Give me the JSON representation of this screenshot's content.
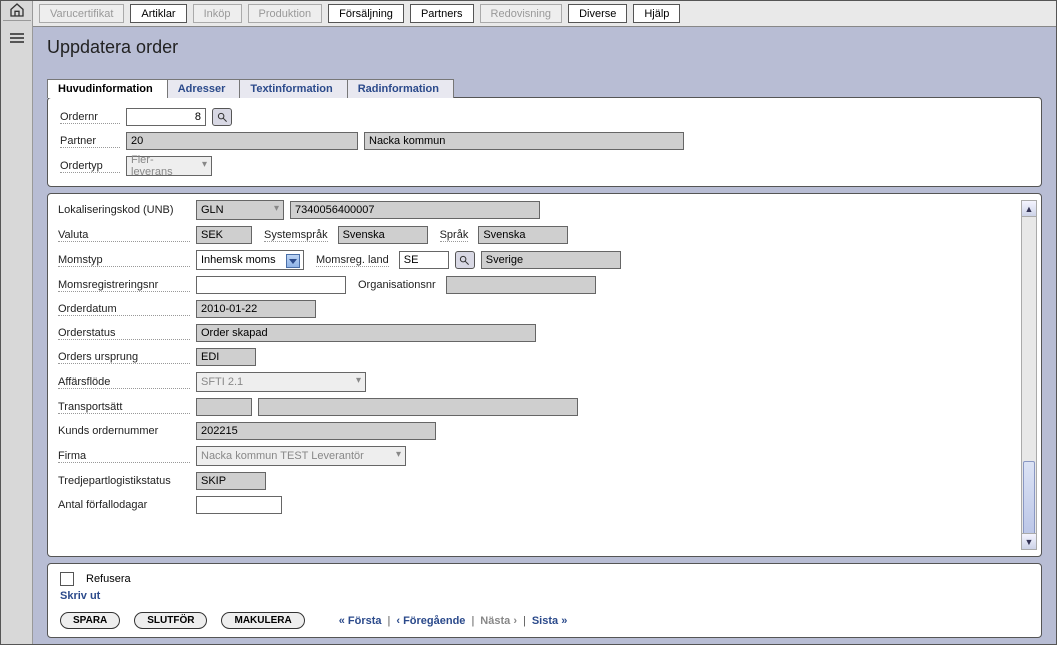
{
  "topnav": {
    "items": [
      {
        "label": "Varucertifikat",
        "disabled": true
      },
      {
        "label": "Artiklar",
        "disabled": false
      },
      {
        "label": "Inköp",
        "disabled": true
      },
      {
        "label": "Produktion",
        "disabled": true
      },
      {
        "label": "Försäljning",
        "disabled": false
      },
      {
        "label": "Partners",
        "disabled": false
      },
      {
        "label": "Redovisning",
        "disabled": true
      },
      {
        "label": "Diverse",
        "disabled": false
      },
      {
        "label": "Hjälp",
        "disabled": false
      }
    ]
  },
  "page": {
    "title": "Uppdatera order"
  },
  "tabs": [
    {
      "label": "Huvudinformation",
      "active": true
    },
    {
      "label": "Adresser",
      "active": false
    },
    {
      "label": "Textinformation",
      "active": false
    },
    {
      "label": "Radinformation",
      "active": false
    }
  ],
  "header_form": {
    "ordernr_label": "Ordernr",
    "ordernr_value": "8",
    "partner_label": "Partner",
    "partner_code": "20",
    "partner_name": "Nacka kommun",
    "ordertyp_label": "Ordertyp",
    "ordertyp_value": "Fler-leverans"
  },
  "details": {
    "lokkod_label": "Lokaliseringskod (UNB)",
    "lokkod_type": "GLN",
    "lokkod_value": "7340056400007",
    "valuta_label": "Valuta",
    "valuta_value": "SEK",
    "systemsprak_label": "Systemspråk",
    "systemsprak_value": "Svenska",
    "sprak_label": "Språk",
    "sprak_value": "Svenska",
    "momstyp_label": "Momstyp",
    "momstyp_value": "Inhemsk moms",
    "momsregland_label": "Momsreg. land",
    "momsregland_code": "SE",
    "momsregland_name": "Sverige",
    "momsregnr_label": "Momsregistreringsnr",
    "momsregnr_value": "",
    "orgnr_label": "Organisationsnr",
    "orgnr_value": "",
    "orderdatum_label": "Orderdatum",
    "orderdatum_value": "2010-01-22",
    "orderstatus_label": "Orderstatus",
    "orderstatus_value": "Order skapad",
    "ursprung_label": "Orders ursprung",
    "ursprung_value": "EDI",
    "affarsflode_label": "Affärsflöde",
    "affarsflode_value": "SFTI 2.1",
    "transportsatt_label": "Transportsätt",
    "transportsatt_code": "",
    "transportsatt_name": "",
    "kundorder_label": "Kunds ordernummer",
    "kundorder_value": "202215",
    "firma_label": "Firma",
    "firma_value": "Nacka kommun TEST Leverantör",
    "tpl_label": "Tredjepartlogistikstatus",
    "tpl_value": "SKIP",
    "forfallo_label": "Antal förfallodagar",
    "forfallo_value": ""
  },
  "footer": {
    "refusera_label": "Refusera",
    "skrivut_label": "Skriv ut",
    "spara": "SPARA",
    "slutfor": "SLUTFÖR",
    "makulera": "MAKULERA",
    "forsta": "« Första",
    "foregaende": "‹ Föregående",
    "nasta": "Nästa ›",
    "sista": "Sista »"
  }
}
